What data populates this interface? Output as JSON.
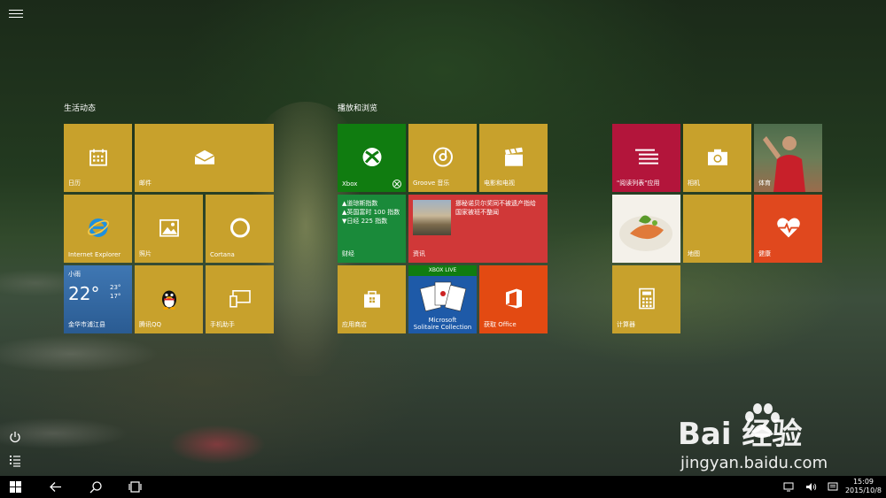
{
  "groups": {
    "life": "生活动态",
    "play": "播放和浏览"
  },
  "tiles": {
    "calendar": "日历",
    "mail": "邮件",
    "ie": "Internet Explorer",
    "photos": "照片",
    "cortana": "Cortana",
    "weather": {
      "city": "小雨",
      "temp": "22°",
      "hi": "23°",
      "lo": "17°",
      "location": "金华市浦江县"
    },
    "qq": "腾讯QQ",
    "phone": "手机助手",
    "xbox": "Xbox",
    "groove": "Groove 音乐",
    "movies": "电影和电视",
    "finance": {
      "label": "财经",
      "lines": [
        "▲道琼斯指数",
        "▲英国富时 100 指数",
        "▼日经 225 指数"
      ]
    },
    "news": {
      "label": "资讯",
      "headline": "挪秘诺贝尔奖同不被遗产指给 国家被班不整闻"
    },
    "store": "应用商店",
    "solitaire": {
      "banner": "XBOX LIVE",
      "line1": "Microsoft",
      "line2": "Solitaire Collection"
    },
    "office": "获取 Office",
    "reading": "\"阅读列表\"应用",
    "camera": "相机",
    "sports": "体育",
    "maps": "地图",
    "health": "健康",
    "calculator": "计算器"
  },
  "taskbar": {
    "time": "15:09",
    "date": "2015/10/8"
  },
  "watermark": {
    "brand": "Bai 经验",
    "url": "jingyan.baidu.com"
  },
  "colors": {
    "tile_gold": "#c8a12c",
    "xbox_green": "#107c10",
    "finance_green": "#1a8a3a",
    "news_red": "#d03838",
    "office_orange": "#e34a12",
    "reading_crimson": "#b3153b",
    "health_orange": "#e0481e"
  }
}
